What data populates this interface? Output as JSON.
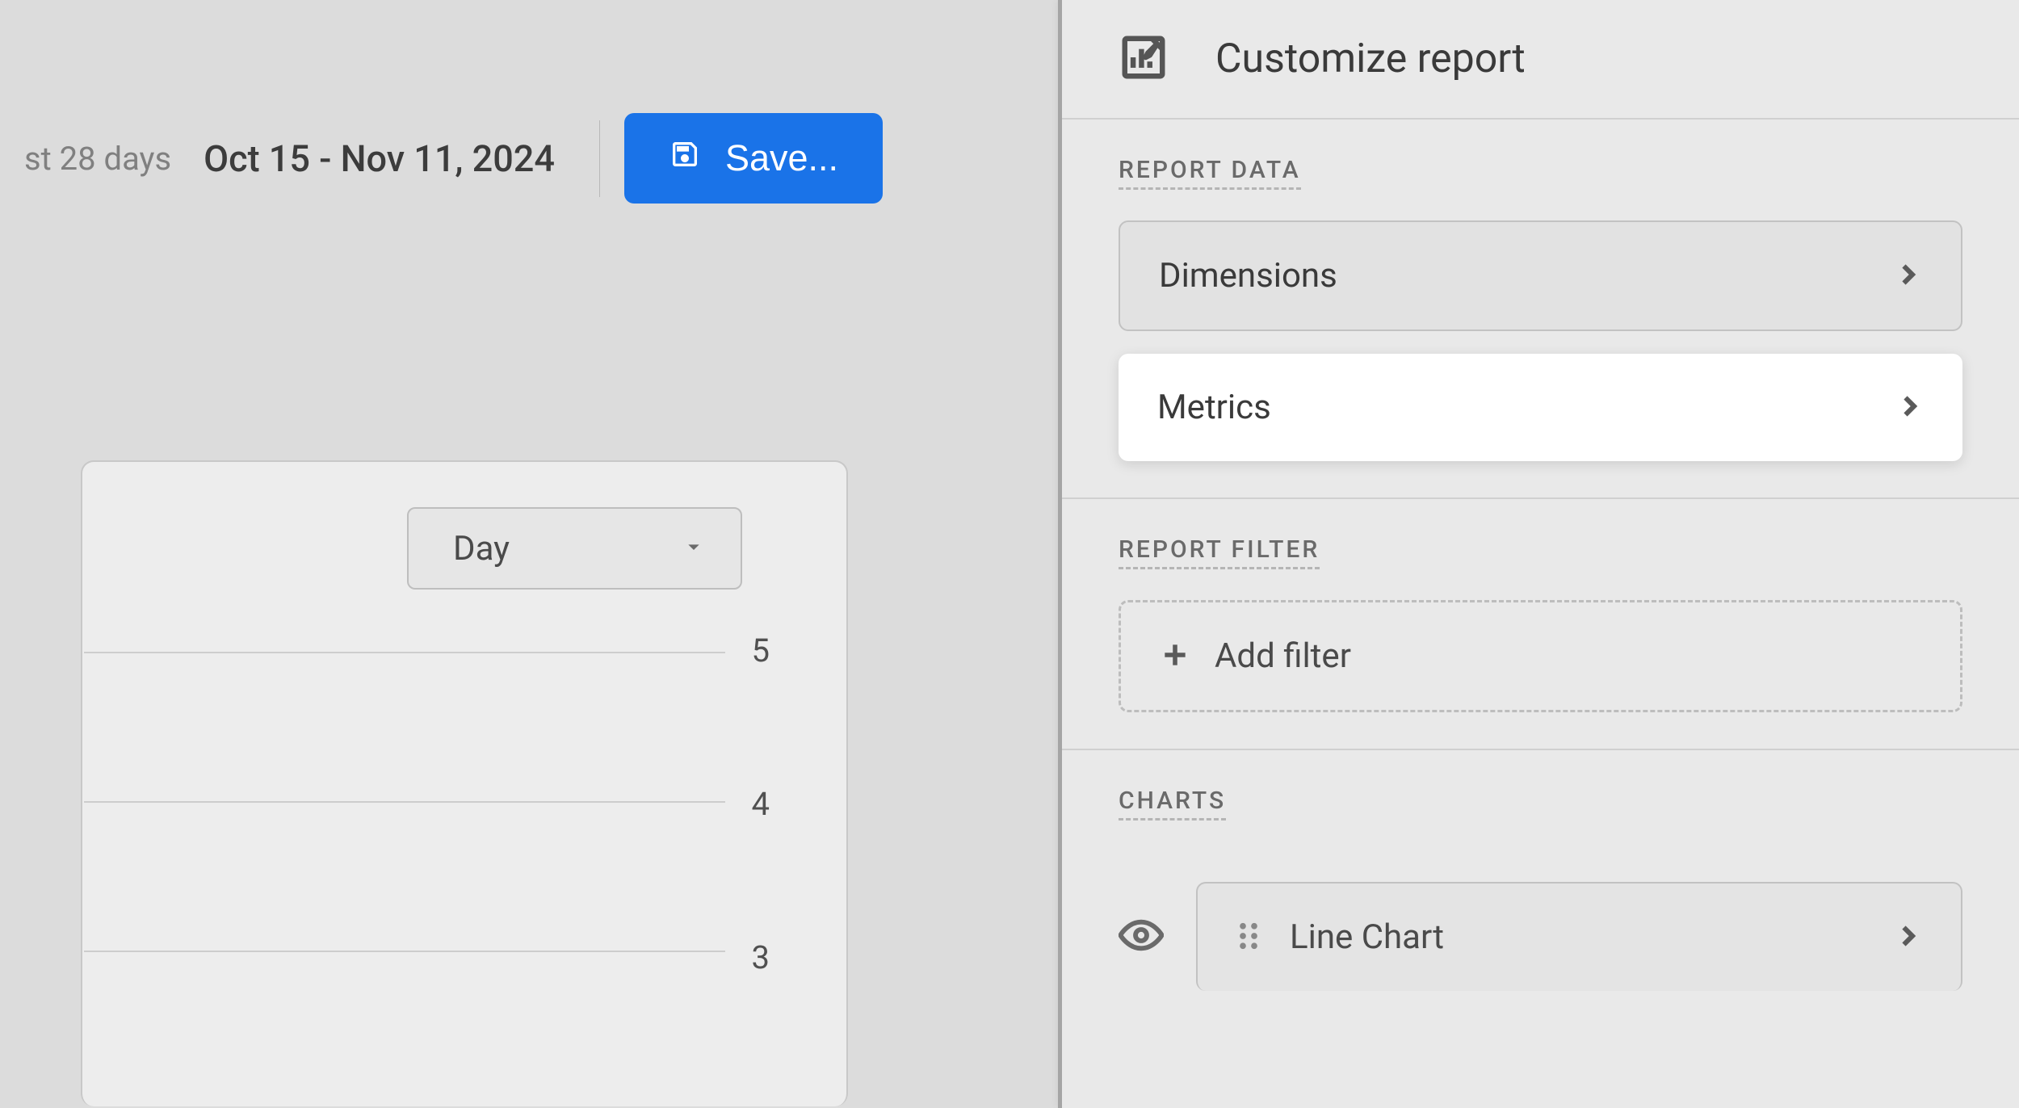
{
  "topbar": {
    "preset_suffix": "st 28 days",
    "date_range": "Oct 15 - Nov 11, 2024",
    "save_label": "Save..."
  },
  "chart": {
    "granularity": "Day",
    "axis_ticks": [
      "5",
      "4",
      "3"
    ]
  },
  "panel": {
    "title": "Customize report",
    "sections": {
      "report_data": {
        "heading": "REPORT DATA",
        "dimensions_label": "Dimensions",
        "metrics_label": "Metrics"
      },
      "report_filter": {
        "heading": "REPORT FILTER",
        "add_filter_label": "Add filter"
      },
      "charts": {
        "heading": "CHARTS",
        "line_chart_label": "Line Chart"
      }
    }
  }
}
